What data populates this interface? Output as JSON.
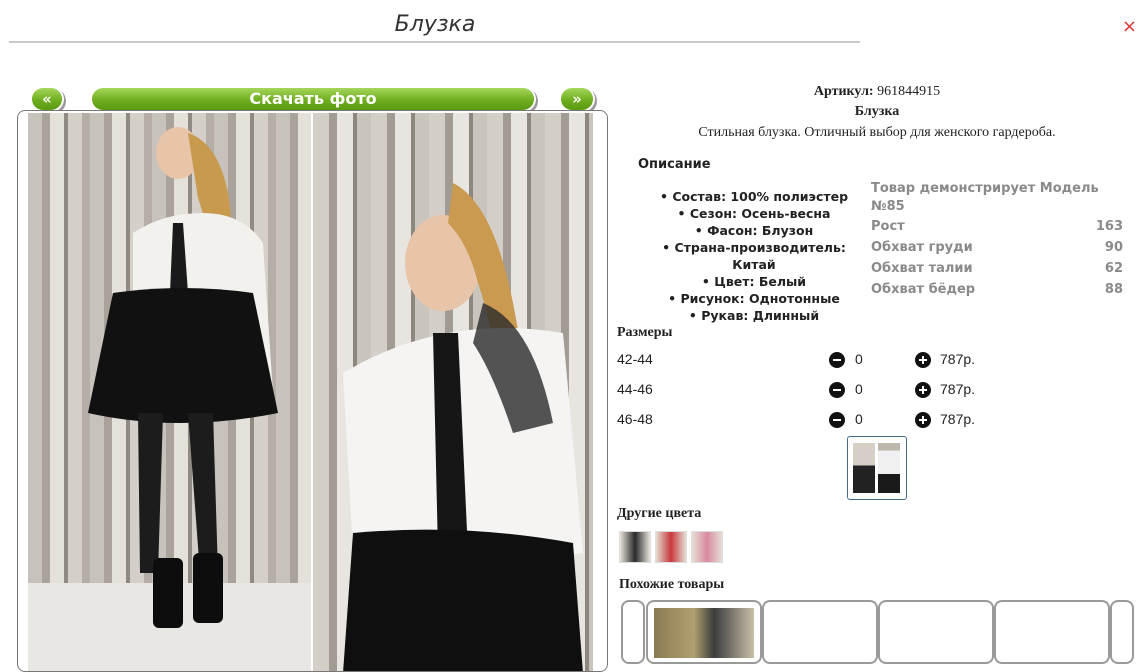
{
  "page": {
    "title": "Блузка",
    "corner_mark": "×"
  },
  "gallery": {
    "prev_label": "«",
    "download_label": "Скачать фото",
    "next_label": "»"
  },
  "product": {
    "sku_label": "Артикул:",
    "sku_value": "961844915",
    "name": "Блузка",
    "tagline": "Стильная блузка. Отличный выбор для женского гардероба.",
    "description_heading": "Описание",
    "attributes": [
      "Состав: 100% полиэстер",
      "Сезон: Осень-весна",
      "Фасон: Блузон",
      "Страна-производитель: Китай",
      "Цвет: Белый",
      "Рисунок: Однотонные",
      "Рукав: Длинный"
    ]
  },
  "model": {
    "heading": "Товар демонстрирует Модель №85",
    "rows": [
      {
        "label": "Рост",
        "value": "163"
      },
      {
        "label": "Обхват груди",
        "value": "90"
      },
      {
        "label": "Обхват талии",
        "value": "62"
      },
      {
        "label": "Обхват бёдер",
        "value": "88"
      }
    ]
  },
  "sizes": {
    "heading": "Размеры",
    "rows": [
      {
        "size": "42-44",
        "qty": "0",
        "price": "787р."
      },
      {
        "size": "44-46",
        "qty": "0",
        "price": "787р."
      },
      {
        "size": "46-48",
        "qty": "0",
        "price": "787р."
      }
    ]
  },
  "other_colors": {
    "heading": "Другие цвета"
  },
  "similar": {
    "heading": "Похожие товары"
  },
  "icons": {
    "minus": "minus-circle-icon",
    "plus": "plus-circle-icon"
  }
}
